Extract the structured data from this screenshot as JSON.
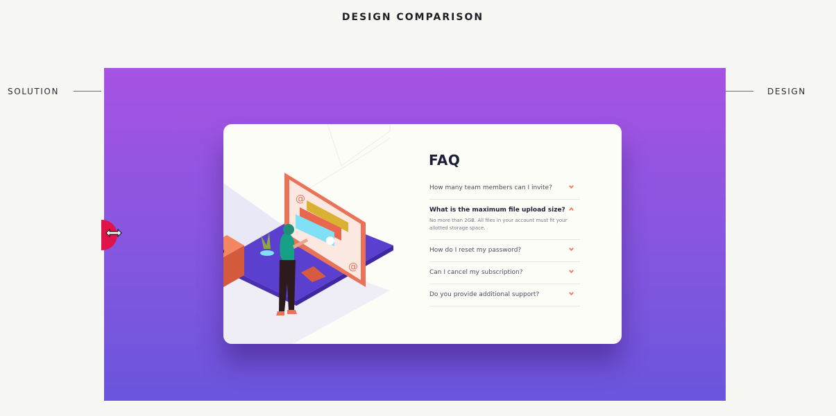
{
  "header": {
    "title": "DESIGN COMPARISON"
  },
  "labels": {
    "left": "SOLUTION",
    "right": "DESIGN"
  },
  "faq": {
    "title": "FAQ",
    "items": [
      {
        "question": "How many team members can I invite?",
        "answer": "",
        "open": false
      },
      {
        "question": "What is the maximum file upload size?",
        "answer": "No more than 2GB. All files in your account must fit your allotted storage space.",
        "open": true
      },
      {
        "question": "How do I reset my password?",
        "answer": "",
        "open": false
      },
      {
        "question": "Can I cancel my subscription?",
        "answer": "",
        "open": false
      },
      {
        "question": "Do you provide additional support?",
        "answer": "",
        "open": false
      }
    ]
  },
  "colors": {
    "accent": "#e0144b",
    "chevron": "#f47b56",
    "gradient_top": "#a752e2",
    "gradient_bottom": "#6a55dc",
    "title": "#1d1e35"
  },
  "icons": {
    "chevron": "chevron-down-icon",
    "chevron_open": "chevron-up-icon",
    "handle": "resize-arrows-icon"
  }
}
